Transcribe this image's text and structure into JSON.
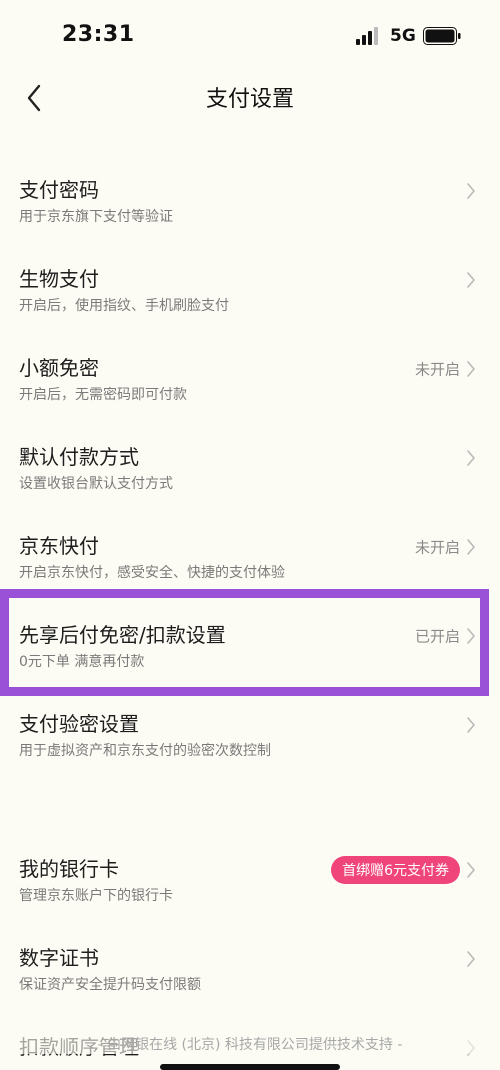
{
  "status_bar": {
    "time": "23:31",
    "network": "5G"
  },
  "nav": {
    "title": "支付设置",
    "back_icon": "chevron-left-icon"
  },
  "settings": [
    {
      "key": "payment-password",
      "title": "支付密码",
      "subtitle": "用于京东旗下支付等验证",
      "status": ""
    },
    {
      "key": "biometric-pay",
      "title": "生物支付",
      "subtitle": "开启后，使用指纹、手机刷脸支付",
      "status": ""
    },
    {
      "key": "small-amount-free",
      "title": "小额免密",
      "subtitle": "开启后，无需密码即可付款",
      "status": "未开启"
    },
    {
      "key": "default-payment",
      "title": "默认付款方式",
      "subtitle": "设置收银台默认支付方式",
      "status": ""
    },
    {
      "key": "jd-quickpay",
      "title": "京东快付",
      "subtitle": "开启京东快付，感受安全、快捷的支付体验",
      "status": "未开启"
    },
    {
      "key": "pay-later",
      "title": "先享后付免密/扣款设置",
      "subtitle": "0元下单 满意再付款",
      "status": "已开启"
    },
    {
      "key": "payment-verification",
      "title": "支付验密设置",
      "subtitle": "用于虚拟资产和京东支付的验密次数控制",
      "status": ""
    }
  ],
  "settings_group2": [
    {
      "key": "bank-cards",
      "title": "我的银行卡",
      "subtitle": "管理京东账户下的银行卡",
      "badge": "首绑赠6元支付券"
    },
    {
      "key": "digital-certificate",
      "title": "数字证书",
      "subtitle": "保证资产安全提升码支付限额",
      "badge": ""
    },
    {
      "key": "deduction-order",
      "title": "扣款顺序管理",
      "subtitle": "",
      "badge": ""
    }
  ],
  "footer": {
    "text": "- 由网银在线 (北京) 科技有限公司提供技术支持 -"
  },
  "colors": {
    "background": "#fdfcf4",
    "highlight": "#9b50d8",
    "badge": "#f0457a"
  }
}
